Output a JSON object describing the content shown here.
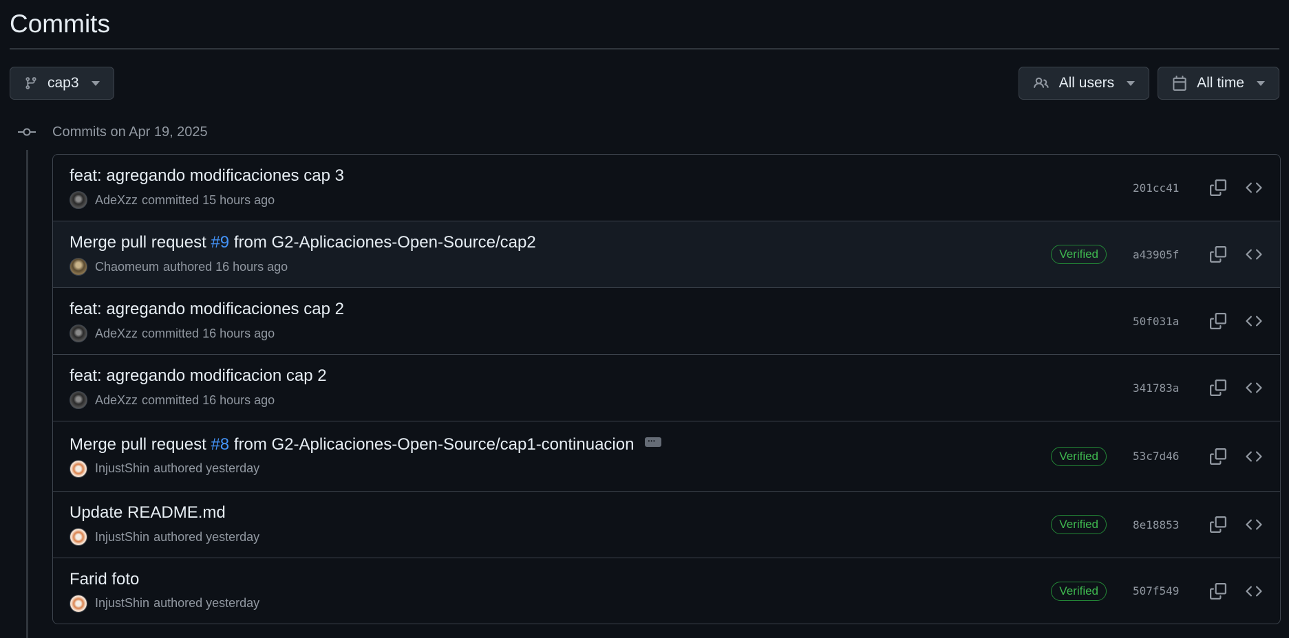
{
  "page": {
    "title": "Commits"
  },
  "toolbar": {
    "branch_label": "cap3",
    "users_label": "All users",
    "time_label": "All time"
  },
  "timeline": {
    "date_label": "Commits on Apr 19, 2025"
  },
  "commits": [
    {
      "title_before": "feat: agregando modificaciones cap 3",
      "pr": "",
      "title_after": "",
      "author": "AdeXzz",
      "action": "committed 15 hours ago",
      "verified": "",
      "sha": "201cc41",
      "avatar": "adexzz"
    },
    {
      "title_before": "Merge pull request ",
      "pr": "#9",
      "title_after": " from G2-Aplicaciones-Open-Source/cap2",
      "author": "Chaomeum",
      "action": "authored 16 hours ago",
      "verified": "Verified",
      "sha": "a43905f",
      "avatar": "chao"
    },
    {
      "title_before": "feat: agregando modificaciones cap 2",
      "pr": "",
      "title_after": "",
      "author": "AdeXzz",
      "action": "committed 16 hours ago",
      "verified": "",
      "sha": "50f031a",
      "avatar": "adexzz"
    },
    {
      "title_before": "feat: agregando modificacion cap 2",
      "pr": "",
      "title_after": "",
      "author": "AdeXzz",
      "action": "committed 16 hours ago",
      "verified": "",
      "sha": "341783a",
      "avatar": "adexzz"
    },
    {
      "title_before": "Merge pull request ",
      "pr": "#8",
      "title_after": " from G2-Aplicaciones-Open-Source/cap1-continuacion",
      "author": "InjustShin",
      "action": "authored yesterday",
      "verified": "Verified",
      "sha": "53c7d46",
      "avatar": "injust"
    },
    {
      "title_before": "Update README.md",
      "pr": "",
      "title_after": "",
      "author": "InjustShin",
      "action": "authored yesterday",
      "verified": "Verified",
      "sha": "8e18853",
      "avatar": "injust"
    },
    {
      "title_before": "Farid foto",
      "pr": "",
      "title_after": "",
      "author": "InjustShin",
      "action": "authored yesterday",
      "verified": "Verified",
      "sha": "507f549",
      "avatar": "injust"
    }
  ],
  "colors": {
    "background": "#0d1117",
    "link": "#4493f8",
    "verified": "#3fb950",
    "border": "#3d444d",
    "muted": "#9198a1"
  }
}
